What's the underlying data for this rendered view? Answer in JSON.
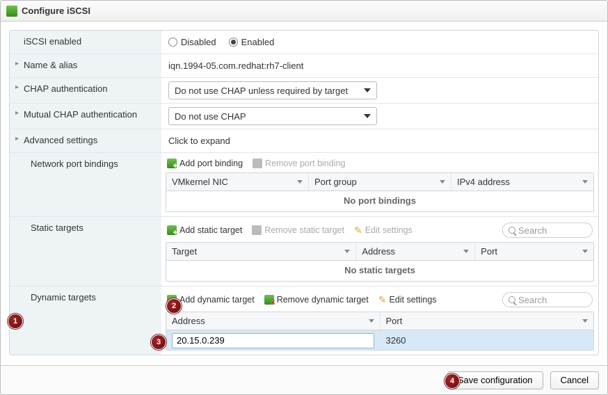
{
  "header": {
    "title": "Configure iSCSI"
  },
  "iscsi_enabled": {
    "label": "iSCSI enabled",
    "disabled_label": "Disabled",
    "enabled_label": "Enabled",
    "value": "enabled"
  },
  "name_alias": {
    "label": "Name & alias",
    "value": "iqn.1994-05.com.redhat:rh7-client"
  },
  "chap": {
    "label": "CHAP authentication",
    "value": "Do not use CHAP unless required by target"
  },
  "mutual_chap": {
    "label": "Mutual CHAP authentication",
    "value": "Do not use CHAP"
  },
  "advanced": {
    "label": "Advanced settings",
    "value": "Click to expand"
  },
  "port_bindings": {
    "label": "Network port bindings",
    "add_label": "Add port binding",
    "remove_label": "Remove port binding",
    "cols": {
      "nic": "VMkernel NIC",
      "group": "Port group",
      "ip": "IPv4 address"
    },
    "empty": "No port bindings"
  },
  "static_targets": {
    "label": "Static targets",
    "add_label": "Add static target",
    "remove_label": "Remove static target",
    "edit_label": "Edit settings",
    "search_placeholder": "Search",
    "cols": {
      "target": "Target",
      "address": "Address",
      "port": "Port"
    },
    "empty": "No static targets"
  },
  "dynamic_targets": {
    "label": "Dynamic targets",
    "add_label": "Add dynamic target",
    "remove_label": "Remove dynamic target",
    "edit_label": "Edit settings",
    "search_placeholder": "Search",
    "cols": {
      "address": "Address",
      "port": "Port"
    },
    "row": {
      "address": "20.15.0.239",
      "port": "3260"
    }
  },
  "footer": {
    "save": "Save configuration",
    "cancel": "Cancel"
  },
  "callouts": {
    "c1": "1",
    "c2": "2",
    "c3": "3",
    "c4": "4"
  }
}
